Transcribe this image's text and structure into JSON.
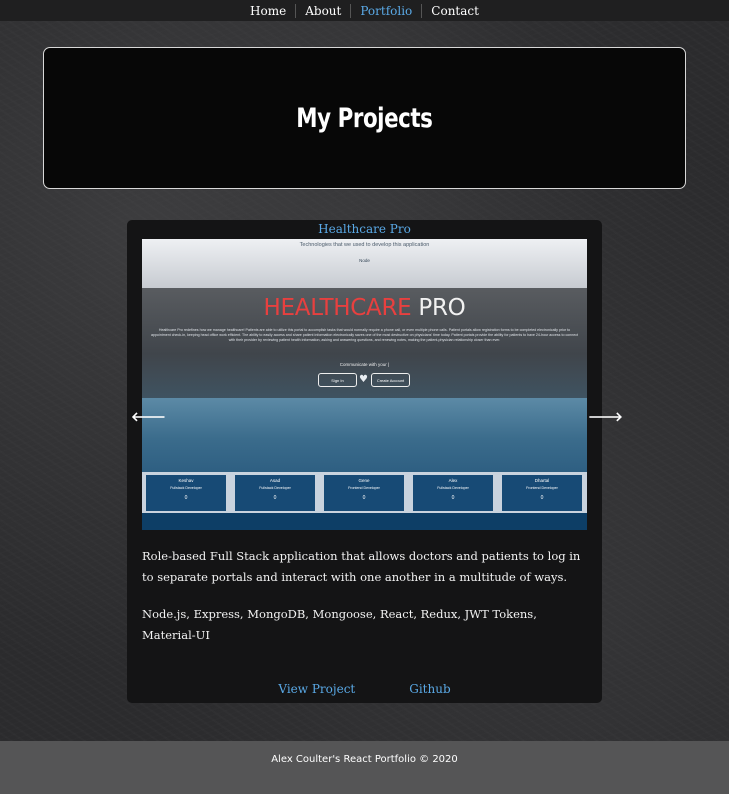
{
  "nav": {
    "items": [
      {
        "label": "Home",
        "active": false
      },
      {
        "label": "About",
        "active": false
      },
      {
        "label": "Portfolio",
        "active": true
      },
      {
        "label": "Contact",
        "active": false
      }
    ]
  },
  "hero": {
    "title": "My Projects"
  },
  "project": {
    "title": "Healthcare Pro",
    "screenshot": {
      "tech_heading": "Technologies that we used to develop this application",
      "tech_items": "Node",
      "logo_red": "HEALTHCARE",
      "logo_white": " PRO",
      "description": "Healthcare Pro redefines how we manage healthcare! Patients are able to utilize this portal to accomplish tasks that would normally require a phone call, or even multiple phone calls. Patient portals allow registration forms to be completed electronically prior to appointment check-in, keeping head office work efficient. The ability to easily access and share patient information electronically saves one of the most destructive on physicians' time today. Patient portals provide the ability for patients to have 24-hour access to connect with their provider by reviewing patient health information, asking and answering questions, and renewing notes, making the patient-physician relationship closer than ever.",
      "communicate": "Communicate with your |",
      "signin": "Sign In",
      "create": "Create Account",
      "team": [
        {
          "name": "Keshav",
          "role": "Fullstack Developer",
          "count": "0"
        },
        {
          "name": "Asad",
          "role": "Fullstack Developer",
          "count": "0"
        },
        {
          "name": "Gene",
          "role": "Frontend Developer",
          "count": "0"
        },
        {
          "name": "Alex",
          "role": "Fullstack Developer",
          "count": "0"
        },
        {
          "name": "Dhartal",
          "role": "Frontend Developer",
          "count": "0"
        }
      ]
    },
    "prev_arrow": "🡐",
    "next_arrow": "🡒",
    "description": "Role-based Full Stack application that allows doctors and patients to log in to separate portals and interact with one another in a multitude of ways.",
    "technologies": "Node.js, Express, MongoDB, Mongoose, React, Redux, JWT Tokens, Material-UI",
    "view_label": "View Project",
    "github_label": "Github"
  },
  "footer": {
    "text": "Alex Coulter's React Portfolio © 2020"
  },
  "colors": {
    "accent": "#5aa9e6",
    "logo_red": "#e8403f",
    "footer_bg": "#555556"
  }
}
